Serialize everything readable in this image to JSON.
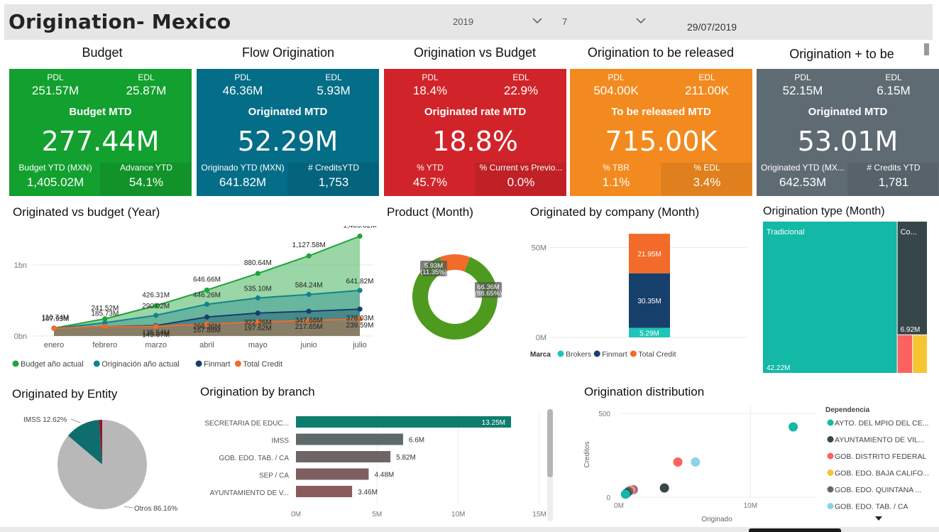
{
  "header": {
    "title": "Origination- Mexico",
    "year": "2019",
    "month": "7",
    "date": "29/07/2019"
  },
  "kpis": [
    {
      "title": "Budget",
      "color": "#12a02e",
      "l1": "PDL",
      "v1": "251.57M",
      "l2": "EDL",
      "v2": "25.87M",
      "mtd_label": "Budget MTD",
      "big": "277.44M",
      "l3": "Budget YTD (MXN)",
      "v3": "1,405.02M",
      "l4": "Advance YTD",
      "v4": "54.1%"
    },
    {
      "title": "Flow Origination",
      "color": "#046d88",
      "l1": "PDL",
      "v1": "46.36M",
      "l2": "EDL",
      "v2": "5.93M",
      "mtd_label": "Originated MTD",
      "big": "52.29M",
      "l3": "Originado YTD (MXN)",
      "v3": "641.82M",
      "l4": "# CreditsYTD",
      "v4": "1,753"
    },
    {
      "title": "Origination vs Budget",
      "color": "#d0242a",
      "l1": "PDL",
      "v1": "18.4%",
      "l2": "EDL",
      "v2": "22.9%",
      "mtd_label": "Originated rate MTD",
      "big": "18.8%",
      "l3": "% YTD",
      "v3": "45.7%",
      "l4": "% Current vs Previo...",
      "v4": "0.0%"
    },
    {
      "title": "Origination to be released",
      "color": "#f38a1f",
      "l1": "PDL",
      "v1": "504.00K",
      "l2": "EDL",
      "v2": "211.00K",
      "mtd_label": "To be released  MTD",
      "big": "715.00K",
      "l3": "% TBR",
      "v3": "1.1%",
      "l4": "% EDL",
      "v4": "3.4%"
    },
    {
      "title": "Origination + to be",
      "color": "#5f6b73",
      "l1": "PDL",
      "v1": "52.15M",
      "l2": "EDL",
      "v2": "6.15M",
      "mtd_label": "Originated  MTD",
      "big": "53.01M",
      "l3": "Originated YTD (MX...",
      "v3": "642.53M",
      "l4": "# Credits YTD",
      "v4": "1,781"
    }
  ],
  "visual_titles": {
    "year": "Originated vs budget (Year)",
    "product": "Product (Month)",
    "company": "Originated by company (Month)",
    "type": "Origination type  (Month)",
    "entity": "Originated by Entity",
    "branch": "Origination by branch",
    "distribution": "Origination distribution"
  },
  "chart_data": [
    {
      "type": "area",
      "title": "Originated vs budget (Year)",
      "categories": [
        "enero",
        "febrero",
        "marzo",
        "abril",
        "mayo",
        "junio",
        "julio"
      ],
      "ylim": [
        0,
        1450
      ],
      "y_ticks": [
        "0bn",
        "1bn"
      ],
      "legend_position": "bottom-left",
      "series": [
        {
          "name": "Budget año actual",
          "color": "#1fa33a",
          "values": [
            110.74,
            241.52,
            426.31,
            646.66,
            880.64,
            1127.58,
            1405.02
          ],
          "labels": [
            "110.74M",
            "241.52M",
            "426.31M",
            "646.66M",
            "880.64M",
            "1,127.58M",
            "1,405.02M"
          ]
        },
        {
          "name": "Originación año actual",
          "color": "#14838f",
          "values": [
            107.93,
            185.73,
            290.02,
            446.26,
            535.1,
            584.24,
            641.82
          ],
          "labels": [
            "107.93M",
            "185.73M",
            "290.02M",
            "446.26M",
            "535.10M",
            "584.24M",
            "641.82M"
          ]
        },
        {
          "name": "Finmart",
          "color": "#173f6b",
          "values": [
            107.93,
            135.54,
            145.67,
            266.36,
            322.26,
            347.68,
            378.03
          ],
          "labels": [
            "",
            "",
            "145.67M",
            "266.36M",
            "322.26M",
            "347.68M",
            "378.03M"
          ]
        },
        {
          "name": "Total Credit",
          "color": "#f26b2a",
          "values": [
            107.93,
            135.54,
            135.54,
            167.88,
            197.62,
            217.65,
            239.59
          ],
          "labels": [
            "",
            "",
            "135.54M",
            "167.88M",
            "197.62M",
            "217.65M",
            "239.59M"
          ]
        }
      ]
    },
    {
      "type": "pie",
      "title": "Product (Month)",
      "slices": [
        {
          "label": "66.36M (88.65%)",
          "value": 88.65,
          "color": "#4e9a1f"
        },
        {
          "label": "5.93M (11.35%)",
          "value": 11.35,
          "color": "#f26b2a"
        }
      ]
    },
    {
      "type": "bar",
      "title": "Originated by company (Month)",
      "ylim": [
        0,
        60
      ],
      "y_ticks": [
        "0M",
        "50M"
      ],
      "legend_title": "Marca",
      "series": [
        {
          "name": "Brokers",
          "color": "#1ec6b9",
          "value": 5.29,
          "label": "5.29M"
        },
        {
          "name": "Finmart",
          "color": "#173f6b",
          "value": 30.35,
          "label": "30.35M"
        },
        {
          "name": "Total Credit",
          "color": "#f26b2a",
          "value": 21.95,
          "label": "21.95M"
        }
      ]
    },
    {
      "type": "treemap",
      "title": "Origination type  (Month)",
      "items": [
        {
          "label": "Tradicional",
          "value_label": "42.22M",
          "value": 42.22,
          "color": "#13b8a6"
        },
        {
          "label": "Co...",
          "value_label": "6.92M",
          "value": 6.92,
          "color": "#374649"
        },
        {
          "label": "",
          "value_label": "",
          "value": 1.2,
          "color": "#fd625e"
        },
        {
          "label": "",
          "value_label": "",
          "value": 1.1,
          "color": "#f5c533"
        }
      ]
    },
    {
      "type": "pie",
      "title": "Originated by Entity",
      "slices": [
        {
          "label": "Otros 86.16%",
          "value": 86.16,
          "color": "#b8b8b8"
        },
        {
          "label": "IMSS 12.62%",
          "value": 12.62,
          "color": "#0f6d6d"
        },
        {
          "label": "",
          "value": 1.22,
          "color": "#8b1a2d"
        }
      ]
    },
    {
      "type": "bar",
      "title": "Origination by branch",
      "orientation": "horizontal",
      "xlim": [
        0,
        15
      ],
      "x_ticks": [
        "0M",
        "5M",
        "10M",
        "15M"
      ],
      "categories": [
        "SECRETARIA DE EDUC...",
        "IMSS",
        "GOB. EDO. TAB. / CA",
        "SEP / CA",
        "AYUNTAMIENTO DE V..."
      ],
      "values": [
        13.25,
        6.6,
        5.82,
        4.48,
        3.46
      ],
      "labels": [
        "13.25M",
        "6.6M",
        "5.82M",
        "4.48M",
        "3.46M"
      ],
      "colors": [
        "#0f7d6d",
        "#5e6a6a",
        "#6f6465",
        "#7d5f5f",
        "#8a5b5b"
      ]
    },
    {
      "type": "scatter",
      "title": "Origination distribution",
      "xlabel": "Originado",
      "ylabel": "Creditos",
      "xlim": [
        0,
        15
      ],
      "ylim": [
        0,
        560
      ],
      "x_ticks": [
        "0M",
        "10M"
      ],
      "y_ticks": [
        "0",
        "500"
      ],
      "legend_title": "Dependencia",
      "legend": [
        {
          "name": "AYTO. DEL MPIO DEL CE...",
          "color": "#13b8a6"
        },
        {
          "name": "AYUNTAMIENTO DE VIL...",
          "color": "#374649"
        },
        {
          "name": "GOB. DISTRITO FEDERAL",
          "color": "#fd625e"
        },
        {
          "name": "GOB. EDO. BAJA CALIFO...",
          "color": "#f5c533"
        },
        {
          "name": "GOB. EDO. QUINTANA ...",
          "color": "#5f6b6d"
        },
        {
          "name": "GOB. EDO. TAB. / CA",
          "color": "#8ad4eb"
        }
      ],
      "points": [
        {
          "x": 13.25,
          "y": 420,
          "color": "#13b8a6"
        },
        {
          "x": 5.82,
          "y": 210,
          "color": "#8ad4eb"
        },
        {
          "x": 4.48,
          "y": 210,
          "color": "#fd625e"
        },
        {
          "x": 3.46,
          "y": 55,
          "color": "#374649"
        },
        {
          "x": 1.1,
          "y": 45,
          "color": "#a66999"
        },
        {
          "x": 0.9,
          "y": 42,
          "color": "#fe9666"
        },
        {
          "x": 0.75,
          "y": 35,
          "color": "#5f6b6d"
        },
        {
          "x": 0.6,
          "y": 25,
          "color": "#374649"
        },
        {
          "x": 0.5,
          "y": 18,
          "color": "#13b8a6"
        }
      ]
    }
  ]
}
